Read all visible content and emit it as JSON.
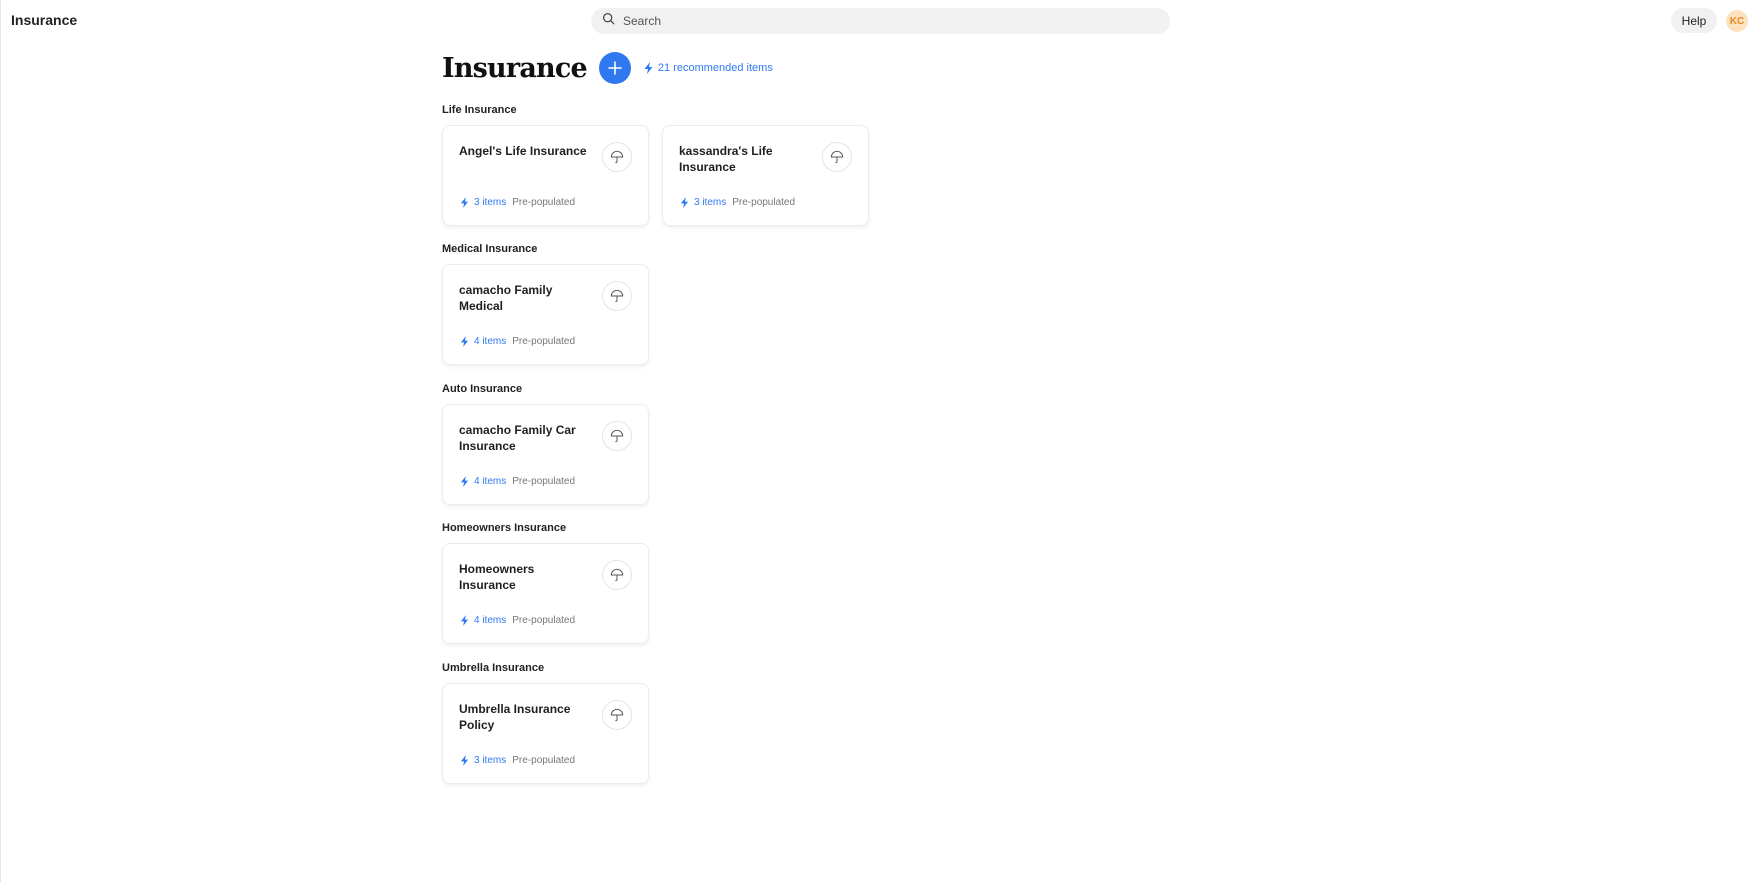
{
  "header": {
    "app_title": "Insurance",
    "search_placeholder": "Search",
    "help_label": "Help",
    "avatar_initials": "KC"
  },
  "page": {
    "title": "Insurance",
    "recommended_label": "21 recommended items"
  },
  "colors": {
    "accent": "#2f78f0",
    "avatar_bg": "#fde2c0",
    "avatar_text": "#e8891d"
  },
  "sections": [
    {
      "title": "Life Insurance",
      "cards": [
        {
          "title": "Angel's Life Insurance",
          "count": "3 items",
          "status": "Pre-populated",
          "icon": "umbrella-icon"
        },
        {
          "title": "kassandra's Life Insurance",
          "count": "3 items",
          "status": "Pre-populated",
          "icon": "umbrella-icon"
        }
      ]
    },
    {
      "title": "Medical Insurance",
      "cards": [
        {
          "title": "camacho Family Medical",
          "count": "4 items",
          "status": "Pre-populated",
          "icon": "umbrella-icon"
        }
      ]
    },
    {
      "title": "Auto Insurance",
      "cards": [
        {
          "title": "camacho Family Car Insurance",
          "count": "4 items",
          "status": "Pre-populated",
          "icon": "umbrella-icon"
        }
      ]
    },
    {
      "title": "Homeowners Insurance",
      "cards": [
        {
          "title": "Homeowners Insurance",
          "count": "4 items",
          "status": "Pre-populated",
          "icon": "umbrella-icon"
        }
      ]
    },
    {
      "title": "Umbrella Insurance",
      "cards": [
        {
          "title": "Umbrella Insurance Policy",
          "count": "3 items",
          "status": "Pre-populated",
          "icon": "umbrella-icon"
        }
      ]
    }
  ]
}
